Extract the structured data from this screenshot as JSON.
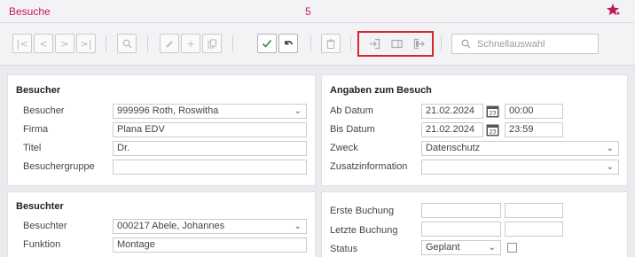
{
  "titlebar": {
    "title": "Besuche",
    "count": "5"
  },
  "colors": {
    "accent": "#c2185b",
    "highlight": "#d9262e",
    "confirm": "#2e8b3e"
  },
  "toolbar": {
    "icons": [
      "first-icon",
      "previous-icon",
      "next-icon",
      "last-icon",
      "search-icon",
      "edit-icon",
      "add-icon",
      "copy-icon",
      "save-check-icon",
      "undo-icon",
      "delete-icon",
      "checkin-icon",
      "card-icon",
      "checkout-icon"
    ],
    "search_placeholder": "Schnellauswahl"
  },
  "besucher": {
    "section": "Besucher",
    "labels": {
      "besucher": "Besucher",
      "firma": "Firma",
      "titel": "Titel",
      "gruppe": "Besuchergruppe"
    },
    "values": {
      "besucher": "999996  Roth, Roswitha",
      "firma": "Plana EDV",
      "titel": "Dr.",
      "gruppe": ""
    }
  },
  "besuch": {
    "section": "Angaben zum Besuch",
    "labels": {
      "ab": "Ab Datum",
      "bis": "Bis Datum",
      "zweck": "Zweck",
      "zusatz": "Zusatzinformation"
    },
    "values": {
      "ab_date": "21.02.2024",
      "ab_time": "00:00",
      "bis_date": "21.02.2024",
      "bis_time": "23:59",
      "zweck": "Datenschutz",
      "zusatz": ""
    },
    "calendar_day": "23"
  },
  "besuchter": {
    "section": "Besuchter",
    "labels": {
      "besuchter": "Besuchter",
      "funktion": "Funktion"
    },
    "values": {
      "besuchter": "000217  Abele, Johannes",
      "funktion": "Montage"
    }
  },
  "buchung": {
    "labels": {
      "erste": "Erste Buchung",
      "letzte": "Letzte Buchung",
      "status": "Status"
    },
    "values": {
      "erste_1": "",
      "erste_2": "",
      "letzte_1": "",
      "letzte_2": "",
      "status": "Geplant"
    }
  }
}
